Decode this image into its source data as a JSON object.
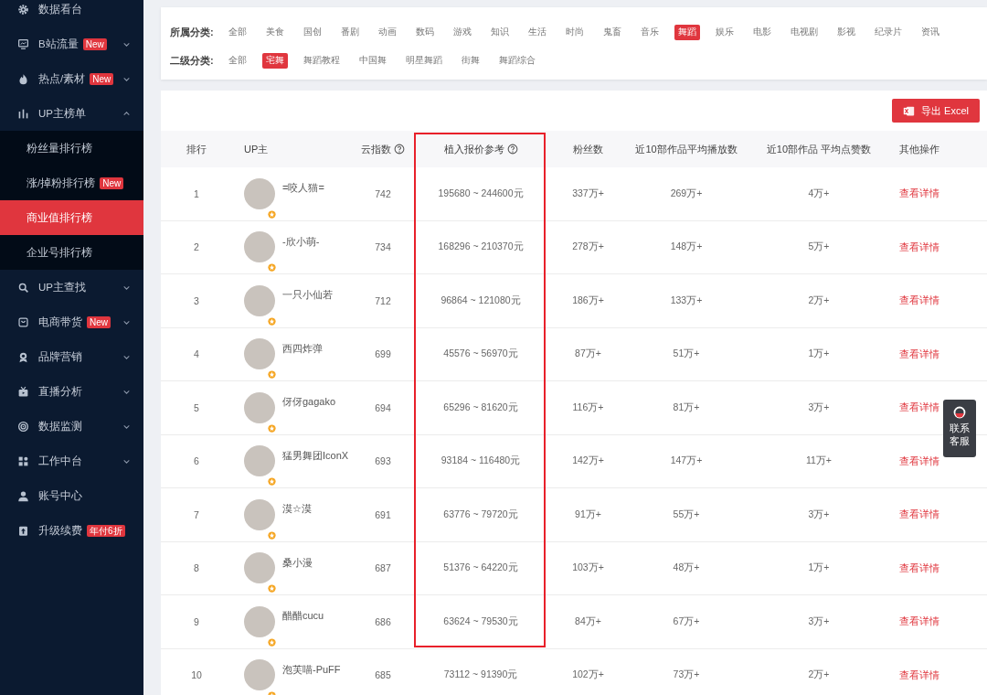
{
  "sidebar": {
    "items": [
      {
        "kind": "link",
        "label": "数据看台"
      },
      {
        "kind": "group",
        "label": "B站流量",
        "badge": "New",
        "expanded": false
      },
      {
        "kind": "group",
        "label": "热点/素材",
        "badge": "New",
        "expanded": false
      },
      {
        "kind": "group",
        "label": "UP主榜单",
        "expanded": true,
        "children": [
          {
            "label": "粉丝量排行榜",
            "selected": false
          },
          {
            "label": "涨/掉粉排行榜",
            "badge": "New",
            "selected": false
          },
          {
            "label": "商业值排行榜",
            "selected": true
          },
          {
            "label": "企业号排行榜",
            "selected": false
          }
        ]
      },
      {
        "kind": "group",
        "label": "UP主查找",
        "expanded": false
      },
      {
        "kind": "group",
        "label": "电商带货",
        "badge": "New",
        "expanded": false
      },
      {
        "kind": "group",
        "label": "品牌营销",
        "expanded": false
      },
      {
        "kind": "group",
        "label": "直播分析",
        "expanded": false
      },
      {
        "kind": "group",
        "label": "数据监测",
        "expanded": false
      },
      {
        "kind": "group",
        "label": "工作中台",
        "expanded": false
      },
      {
        "kind": "link",
        "label": "账号中心"
      },
      {
        "kind": "link",
        "label": "升级续费",
        "badge": "年付6折"
      }
    ]
  },
  "filters": [
    {
      "label": "所属分类:",
      "options": [
        {
          "label": "全部",
          "selected": false
        },
        {
          "label": "美食",
          "selected": false
        },
        {
          "label": "国创",
          "selected": false
        },
        {
          "label": "番剧",
          "selected": false
        },
        {
          "label": "动画",
          "selected": false
        },
        {
          "label": "数码",
          "selected": false
        },
        {
          "label": "游戏",
          "selected": false
        },
        {
          "label": "知识",
          "selected": false
        },
        {
          "label": "生活",
          "selected": false
        },
        {
          "label": "时尚",
          "selected": false
        },
        {
          "label": "鬼畜",
          "selected": false
        },
        {
          "label": "音乐",
          "selected": false
        },
        {
          "label": "舞蹈",
          "selected": true
        },
        {
          "label": "娱乐",
          "selected": false
        },
        {
          "label": "电影",
          "selected": false
        },
        {
          "label": "电视剧",
          "selected": false
        },
        {
          "label": "影视",
          "selected": false
        },
        {
          "label": "纪录片",
          "selected": false
        },
        {
          "label": "资讯",
          "selected": false
        }
      ]
    },
    {
      "label": "二级分类:",
      "options": [
        {
          "label": "全部",
          "selected": false
        },
        {
          "label": "宅舞",
          "selected": true
        },
        {
          "label": "舞蹈教程",
          "selected": false
        },
        {
          "label": "中国舞",
          "selected": false
        },
        {
          "label": "明星舞蹈",
          "selected": false
        },
        {
          "label": "街舞",
          "selected": false
        },
        {
          "label": "舞蹈综合",
          "selected": false
        }
      ]
    }
  ],
  "export_button": "导出 Excel",
  "table": {
    "columns": [
      {
        "label": "排行"
      },
      {
        "label": "UP主"
      },
      {
        "label": "云指数",
        "help": true
      },
      {
        "label": "植入报价参考",
        "help": true,
        "highlighted": true
      },
      {
        "label": "粉丝数"
      },
      {
        "label": "近10部作品平均播放数"
      },
      {
        "label": "近10部作品 平均点赞数"
      },
      {
        "label": "其他操作"
      }
    ],
    "rows": [
      {
        "rank": "1",
        "name": "=咬人猫=",
        "index": "742",
        "price": "195680 ~ 244600元",
        "fans": "337万+",
        "plays": "269万+",
        "likes": "4万+",
        "action": "查看详情"
      },
      {
        "rank": "2",
        "name": "-欣小萌-",
        "index": "734",
        "price": "168296 ~ 210370元",
        "fans": "278万+",
        "plays": "148万+",
        "likes": "5万+",
        "action": "查看详情"
      },
      {
        "rank": "3",
        "name": "一只小仙若",
        "index": "712",
        "price": "96864 ~ 121080元",
        "fans": "186万+",
        "plays": "133万+",
        "likes": "2万+",
        "action": "查看详情"
      },
      {
        "rank": "4",
        "name": "西四炸弹",
        "index": "699",
        "price": "45576 ~ 56970元",
        "fans": "87万+",
        "plays": "51万+",
        "likes": "1万+",
        "action": "查看详情"
      },
      {
        "rank": "5",
        "name": "伢伢gagako",
        "index": "694",
        "price": "65296 ~ 81620元",
        "fans": "116万+",
        "plays": "81万+",
        "likes": "3万+",
        "action": "查看详情"
      },
      {
        "rank": "6",
        "name": "猛男舞团IconX",
        "index": "693",
        "price": "93184 ~ 116480元",
        "fans": "142万+",
        "plays": "147万+",
        "likes": "11万+",
        "action": "查看详情"
      },
      {
        "rank": "7",
        "name": "漠☆漠",
        "index": "691",
        "price": "63776 ~ 79720元",
        "fans": "91万+",
        "plays": "55万+",
        "likes": "3万+",
        "action": "查看详情"
      },
      {
        "rank": "8",
        "name": "桑小漫",
        "index": "687",
        "price": "51376 ~ 64220元",
        "fans": "103万+",
        "plays": "48万+",
        "likes": "1万+",
        "action": "查看详情"
      },
      {
        "rank": "9",
        "name": "醋醋cucu",
        "index": "686",
        "price": "63624 ~ 79530元",
        "fans": "84万+",
        "plays": "67万+",
        "likes": "3万+",
        "action": "查看详情"
      },
      {
        "rank": "10",
        "name": "泡芙喵-PuFF",
        "index": "685",
        "price": "73112 ~ 91390元",
        "fans": "102万+",
        "plays": "73万+",
        "likes": "2万+",
        "action": "查看详情"
      }
    ]
  },
  "support_widget": "联系客服"
}
